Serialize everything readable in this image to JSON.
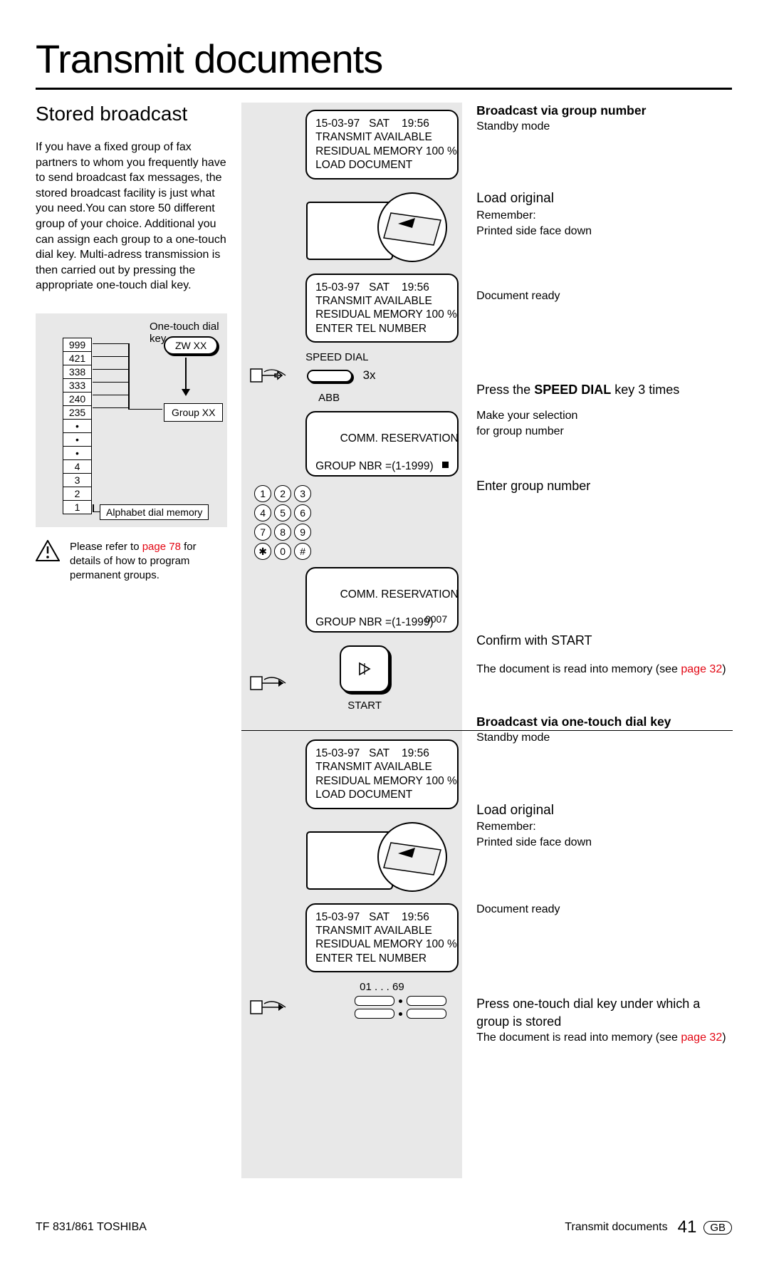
{
  "title": "Transmit documents",
  "section": "Stored broadcast",
  "intro": "If you have a fixed group of fax partners to whom you frequently have to send broadcast fax messages, the stored broadcast facility is just what you need.You can store 50 different group of your choice. Additional you can assign each group to a one-touch dial key. Multi-adress transmission is then carried out by pressing the appropriate one-touch dial key.",
  "diagram": {
    "label_top": "One-touch dial key",
    "zw": "ZW XX",
    "group": "Group XX",
    "alpha": "Alphabet dial memory",
    "rows": [
      "999",
      "421",
      "338",
      "333",
      "240",
      "235",
      "•",
      "•",
      "•",
      "4",
      "3",
      "2",
      "1"
    ]
  },
  "warn": {
    "pre": "Please refer to ",
    "page": "page 78",
    "post": " for details of how to program permanent groups."
  },
  "lcd1": "15-03-97   SAT    19:56\nTRANSMIT AVAILABLE\nRESIDUAL MEMORY 100 %\nLOAD DOCUMENT",
  "lcd2": "15-03-97   SAT    19:56\nTRANSMIT AVAILABLE\nRESIDUAL MEMORY 100 %\nENTER TEL NUMBER",
  "speed": {
    "label": "SPEED DIAL",
    "x": "3x",
    "abb": "ABB"
  },
  "lcd3": "COMM. RESERVATION\n\nGROUP NBR =(1-1999)",
  "keypad": [
    [
      "1",
      "2",
      "3"
    ],
    [
      "4",
      "5",
      "6"
    ],
    [
      "7",
      "8",
      "9"
    ],
    [
      "✱",
      "0",
      "#"
    ]
  ],
  "lcd4": "COMM. RESERVATION\n\nGROUP NBR =(1-1999)",
  "lcd4_sub": "0007",
  "start_label": "START",
  "otd_label": "01 . . . 69",
  "right": {
    "a1_h": "Broadcast via group number",
    "a1_s": "Standby mode",
    "a2_h": "Load original",
    "a2_s": "Remember:\nPrinted side face down",
    "a3": "Document ready",
    "a4_pre": "Press the ",
    "a4_b": "SPEED DIAL",
    "a4_post": " key 3 times",
    "a4_s": "Make your selection\nfor group number",
    "a5": "Enter group number",
    "a6_h": "Confirm with START",
    "a6_pre": "The document is read into memory (see ",
    "a6_page": "page 32",
    "a6_post": ")",
    "b1_h": "Broadcast via one-touch dial key",
    "b1_s": "Standby mode",
    "b2_h": "Load original",
    "b2_s": "Remember:\nPrinted side face down",
    "b3": "Document ready",
    "b4_h": "Press one-touch dial key under which a group is stored",
    "b4_pre": "The document is read into memory (see ",
    "b4_page": "page 32",
    "b4_post": ")"
  },
  "footer": {
    "left": "TF 831/861 TOSHIBA",
    "right_text": "Transmit documents",
    "page": "41",
    "gb": "GB"
  }
}
